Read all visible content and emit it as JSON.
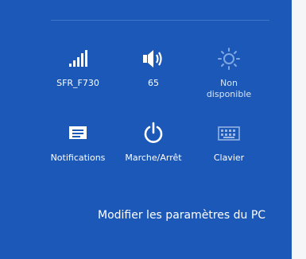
{
  "tiles": {
    "network": {
      "label": "SFR_F730",
      "icon": "wifi-signal-icon"
    },
    "volume": {
      "label": "65",
      "icon": "speaker-icon"
    },
    "brightness": {
      "label_line1": "Non",
      "label_line2": "disponible",
      "icon": "brightness-icon"
    },
    "notifications": {
      "label": "Notifications",
      "icon": "notifications-icon"
    },
    "power": {
      "label": "Marche/Arrêt",
      "icon": "power-icon"
    },
    "keyboard": {
      "label": "Clavier",
      "icon": "keyboard-icon"
    }
  },
  "footer": {
    "pc_settings_label": "Modifier les paramètres du PC"
  },
  "colors": {
    "panel_bg": "#1b58b8",
    "text": "#ffffff",
    "disabled_icon": "#7fa8e3"
  }
}
